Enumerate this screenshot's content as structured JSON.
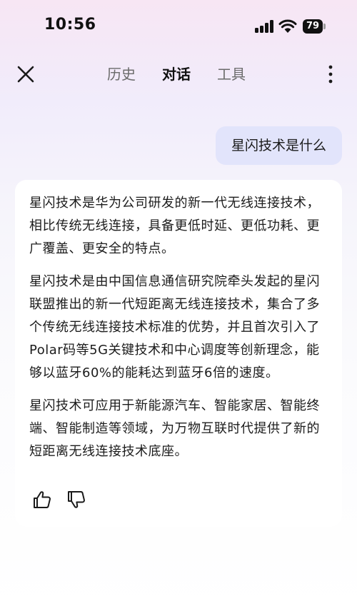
{
  "status_bar": {
    "time": "10:56",
    "battery_level": "79",
    "icons": [
      "signal-icon",
      "wifi-icon",
      "battery-icon"
    ]
  },
  "nav": {
    "close_icon": "close-icon",
    "tabs": [
      {
        "label": "历史",
        "active": false
      },
      {
        "label": "对话",
        "active": true
      },
      {
        "label": "工具",
        "active": false
      }
    ],
    "more_icon": "more-vertical-icon"
  },
  "conversation": {
    "user_message": "星闪技术是什么",
    "answer_paragraphs": [
      "星闪技术是华为公司研发的新一代无线连接技术，相比传统无线连接，具备更低时延、更低功耗、更广覆盖、更安全的特点。",
      "星闪技术是由中国信息通信研究院牵头发起的星闪联盟推出的新一代短距离无线连接技术，集合了多个传统无线连接技术标准的优势，并且首次引入了Polar码等5G关键技术和中心调度等创新理念，能够以蓝牙60%的能耗达到蓝牙6倍的速度。",
      "星闪技术可应用于新能源汽车、智能家居、智能终端、智能制造等领域，为万物互联时代提供了新的短距离无线连接技术底座。"
    ],
    "feedback_icons": [
      "thumbs-up-icon",
      "thumbs-down-icon"
    ]
  }
}
